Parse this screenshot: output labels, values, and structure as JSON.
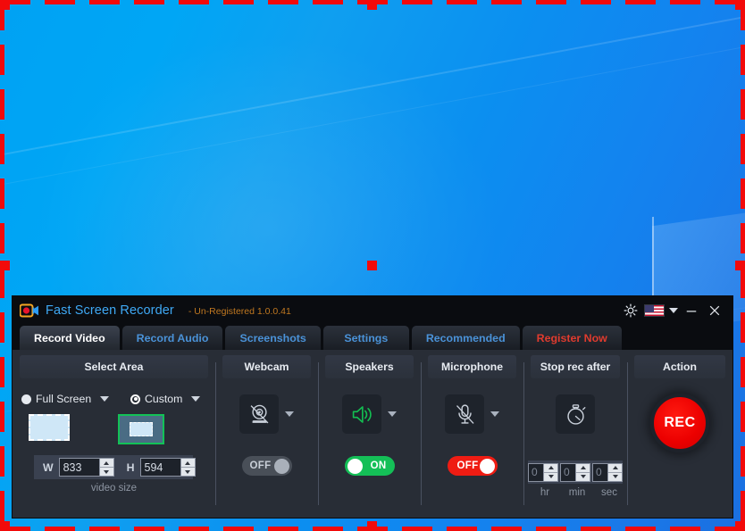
{
  "titlebar": {
    "logo_icon": "video-camera-icon",
    "app_title": "Fast Screen Recorder",
    "version_label": "- Un-Registered 1.0.0.41",
    "settings_icon": "gear-icon",
    "flag_icon": "us-flag-icon",
    "language_caret_icon": "chevron-down-icon",
    "minimize_label": "—",
    "close_label": "✕"
  },
  "tabs": [
    {
      "label": "Record Video",
      "state": "active"
    },
    {
      "label": "Record Audio",
      "state": "inactive"
    },
    {
      "label": "Screenshots",
      "state": "inactive"
    },
    {
      "label": "Settings",
      "state": "inactive"
    },
    {
      "label": "Recommended",
      "state": "inactive"
    },
    {
      "label": "Register Now",
      "state": "register"
    }
  ],
  "panels": {
    "select_area": {
      "header": "Select Area",
      "full_screen": {
        "label": "Full Screen",
        "selected": false,
        "caret_icon": "chevron-down-icon",
        "thumbnail_name": "fullscreen-thumbnail"
      },
      "custom": {
        "label": "Custom",
        "selected": true,
        "caret_icon": "chevron-down-icon",
        "thumbnail_name": "custom-area-thumbnail"
      },
      "width_label": "W",
      "width_value": "833",
      "height_label": "H",
      "height_value": "594",
      "caption": "video size"
    },
    "webcam": {
      "header": "Webcam",
      "icon": "webcam-disabled-icon",
      "caret_icon": "chevron-down-icon",
      "toggle_label": "OFF",
      "toggle_state": "off",
      "toggle_color": "#494f58"
    },
    "speakers": {
      "header": "Speakers",
      "icon": "speaker-volume-icon",
      "caret_icon": "chevron-down-icon",
      "toggle_label": "ON",
      "toggle_state": "on",
      "toggle_color": "#14bf57"
    },
    "microphone": {
      "header": "Microphone",
      "icon": "microphone-muted-icon",
      "caret_icon": "chevron-down-icon",
      "toggle_label": "OFF",
      "toggle_state": "off",
      "toggle_color": "#ef1c13"
    },
    "stop_rec_after": {
      "header": "Stop rec after",
      "icon": "stopwatch-icon",
      "hours_value": "0",
      "minutes_value": "0",
      "seconds_value": "0",
      "hours_label": "hr",
      "minutes_label": "min",
      "seconds_label": "sec"
    },
    "action": {
      "header": "Action",
      "rec_label": "REC",
      "rec_color": "#ec0000"
    }
  },
  "capture_region": {
    "border_color": "#f20a0a",
    "border_style": "dashed",
    "handle_count": 9
  },
  "desktop": {
    "wallpaper": "windows-10-blue-hero-wallpaper",
    "accent_color": "#00a2f3"
  }
}
